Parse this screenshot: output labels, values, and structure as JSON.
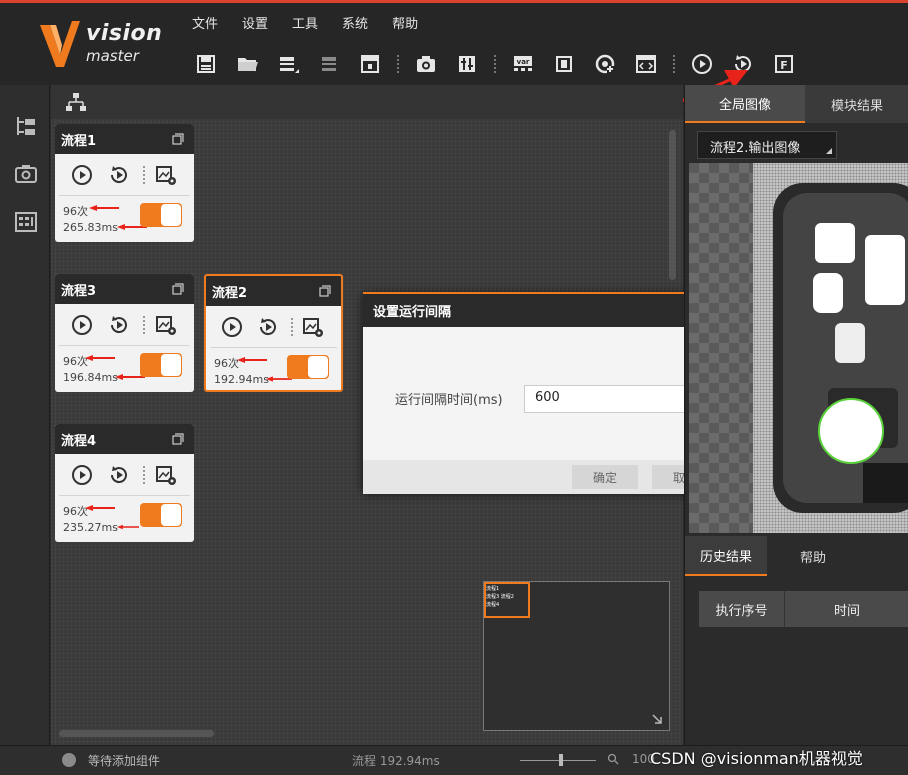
{
  "app": {
    "brand_line1": "vision",
    "brand_line2": "master"
  },
  "menu": [
    "文件",
    "设置",
    "工具",
    "系统",
    "帮助"
  ],
  "toolbar_icons": [
    "save-icon",
    "open-folder-icon",
    "save-as-icon",
    "import-icon",
    "lock-icon",
    "camera-icon",
    "calibration-icon",
    "variable-icon",
    "io-icon",
    "communication-icon",
    "script-icon",
    "run-once-icon",
    "run-continuous-icon",
    "formula-icon"
  ],
  "toolbar_var_label": "var",
  "toolbar_formula_label": "F",
  "flows": [
    {
      "title": "流程1",
      "count": "96次",
      "time": "265.83ms",
      "enabled": true
    },
    {
      "title": "流程3",
      "count": "96次",
      "time": "196.84ms",
      "enabled": true
    },
    {
      "title": "流程2",
      "count": "96次",
      "time": "192.94ms",
      "enabled": true
    },
    {
      "title": "流程4",
      "count": "96次",
      "time": "235.27ms",
      "enabled": true
    }
  ],
  "minimap_labels": [
    "流程1",
    "流程3 流程2",
    "流程4"
  ],
  "dialog": {
    "title": "设置运行间隔",
    "label": "运行间隔时间(ms)",
    "value": "600",
    "ok": "确定",
    "cancel": "取消"
  },
  "right_panel": {
    "tabs": [
      "全局图像",
      "模块结果"
    ],
    "image_source": "流程2.输出图像",
    "bottom_tabs": [
      "历史结果",
      "帮助"
    ],
    "table_headers": [
      "执行序号",
      "时间"
    ]
  },
  "status": {
    "text": "等待添加组件",
    "flow_time": "流程 192.94ms",
    "zoom": "100"
  },
  "watermark": "CSDN @visionman机器视觉",
  "colors": {
    "accent": "#f07a1e",
    "annotation": "#e8231a",
    "header_bg": "#262626"
  }
}
